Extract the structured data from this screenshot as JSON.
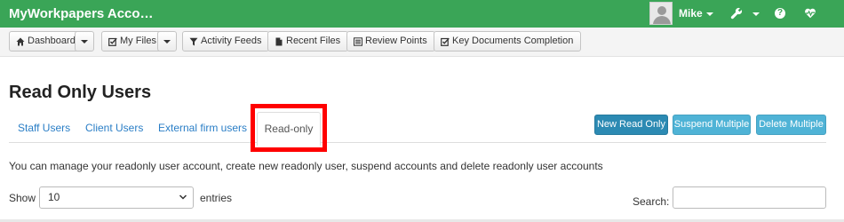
{
  "header": {
    "app_title": "MyWorkpapers Acco…",
    "user_name": "Mike",
    "accent_color": "#3aa557",
    "icons": [
      "user-avatar",
      "wrench-icon",
      "help-icon",
      "heartbeat-icon"
    ]
  },
  "navbar": {
    "dashboard": "Dashboard",
    "my_files": "My Files",
    "activity_feeds": "Activity Feeds",
    "recent_files": "Recent Files",
    "review_points": "Review Points",
    "key_documents": "Key Documents Completion"
  },
  "page": {
    "title": "Read Only Users",
    "description": "You can manage your readonly user account, create new readonly user, suspend accounts and delete readonly user accounts"
  },
  "tabs": {
    "staff": "Staff Users",
    "client": "Client Users",
    "external": "External firm users",
    "readonly": "Read-only",
    "active": "Read-only"
  },
  "actions": {
    "new_read_only": "New Read Only",
    "suspend_multiple": "Suspend Multiple",
    "delete_multiple": "Delete Multiple",
    "primary_color": "#2c8ab3",
    "info_color": "#4fb3d6"
  },
  "table_controls": {
    "show_label": "Show",
    "entries_value": "10",
    "entries_label": "entries",
    "search_label": "Search:",
    "search_value": ""
  }
}
